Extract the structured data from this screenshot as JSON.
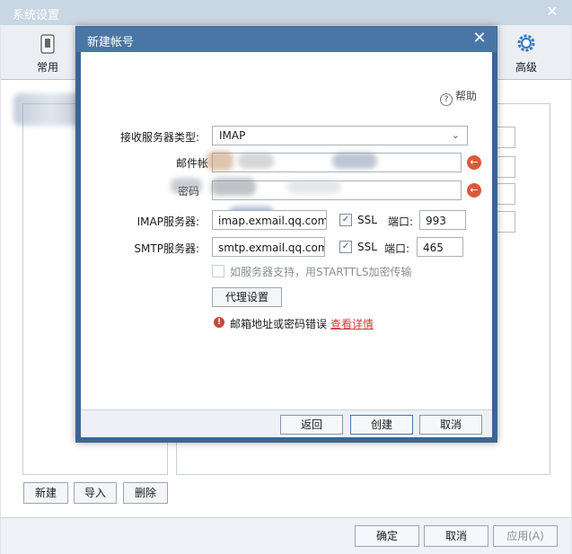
{
  "outer": {
    "title": "系统设置",
    "toolbar": {
      "general_label": "常用",
      "advanced_label": "高级"
    },
    "left_buttons": {
      "new": "新建",
      "import": "导入",
      "delete": "删除"
    },
    "footer": {
      "ok": "确定",
      "cancel": "取消",
      "apply": "应用(A)"
    }
  },
  "dialog": {
    "title": "新建帐号",
    "help": "帮助",
    "fields": {
      "server_type_label": "接收服务器类型:",
      "server_type_value": "IMAP",
      "email_label": "邮件帐",
      "password_label": "密码",
      "imap_label": "IMAP服务器:",
      "imap_value": "imap.exmail.qq.com",
      "imap_ssl": "SSL",
      "imap_port_label": "端口:",
      "imap_port": "993",
      "smtp_label": "SMTP服务器:",
      "smtp_value": "smtp.exmail.qq.com",
      "smtp_ssl": "SSL",
      "smtp_port_label": "端口:",
      "smtp_port": "465",
      "starttls_label": "如服务器支持，用STARTTLS加密传输",
      "proxy_button": "代理设置",
      "error_text": "邮箱地址或密码错误",
      "error_link": "查看详情"
    },
    "buttons": {
      "back": "返回",
      "create": "创建",
      "cancel": "取消"
    }
  },
  "colors": {
    "dialog_title": "#4a76a6",
    "error": "#c9473b",
    "clear_icon": "#d85a3b",
    "link": "#cf3a3a"
  },
  "icons": {
    "general": "phone-icon",
    "advanced": "gear-icon",
    "help": "question-circle-icon",
    "clear": "clear-left-arrow-icon",
    "error": "error-exclamation-icon"
  }
}
